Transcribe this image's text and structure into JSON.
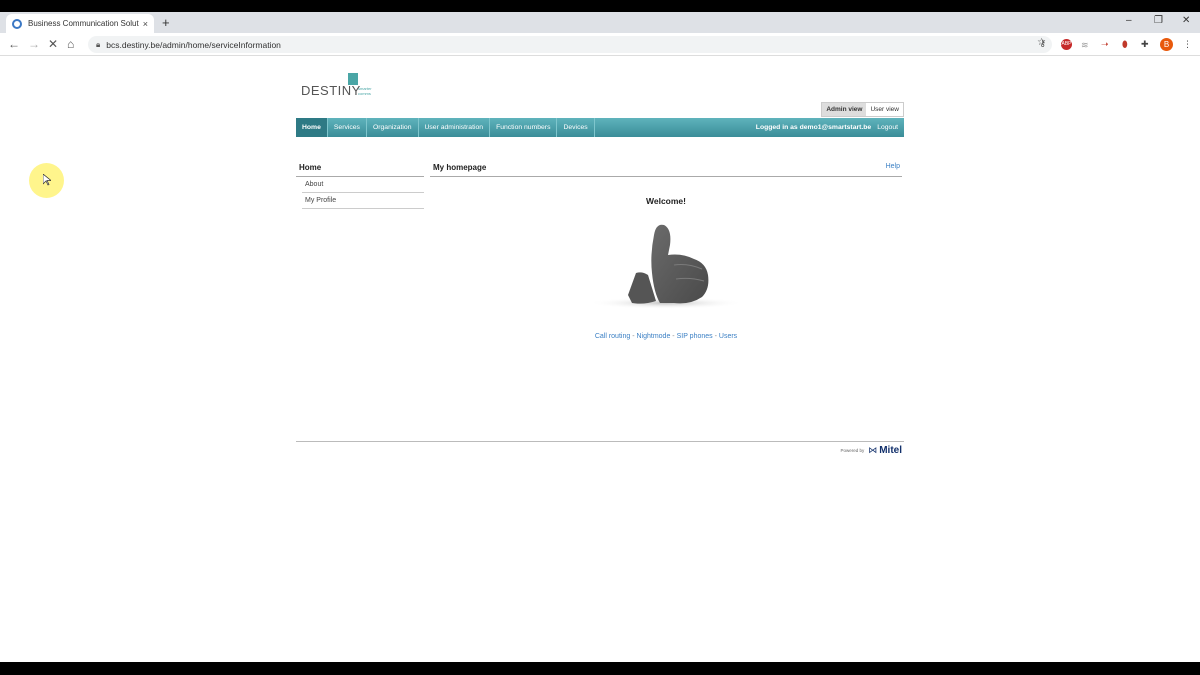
{
  "browser": {
    "tab_title": "Business Communication Solutio",
    "tab_close": "×",
    "new_tab": "+",
    "url": "bcs.destiny.be/admin/home/serviceInformation",
    "profile_initial": "B",
    "window_controls": [
      "–",
      "❐",
      "✕"
    ]
  },
  "logo": {
    "name": "DESTINY",
    "tagline_line1": "smarter",
    "tagline_line2": "comms"
  },
  "view_tabs": [
    {
      "label": "Admin view",
      "active": true
    },
    {
      "label": "User view",
      "active": false
    }
  ],
  "nav": {
    "items": [
      "Home",
      "Services",
      "Organization",
      "User administration",
      "Function numbers",
      "Devices"
    ],
    "logged_in": "Logged in as demo1@smartstart.be",
    "logout": "Logout"
  },
  "sidebar": {
    "heading": "Home",
    "items": [
      "About",
      "My Profile"
    ]
  },
  "content": {
    "title": "My homepage",
    "help": "Help",
    "welcome": "Welcome!",
    "links": [
      "Call routing",
      "Nightmode",
      "SIP phones",
      "Users"
    ],
    "separator": " - "
  },
  "footer": {
    "powered_label": "Powered by",
    "brand": "Mitel"
  },
  "colors": {
    "nav_accent": "#3a8d98",
    "link": "#3a7fc4",
    "logo_teal": "#4aa6a6"
  }
}
